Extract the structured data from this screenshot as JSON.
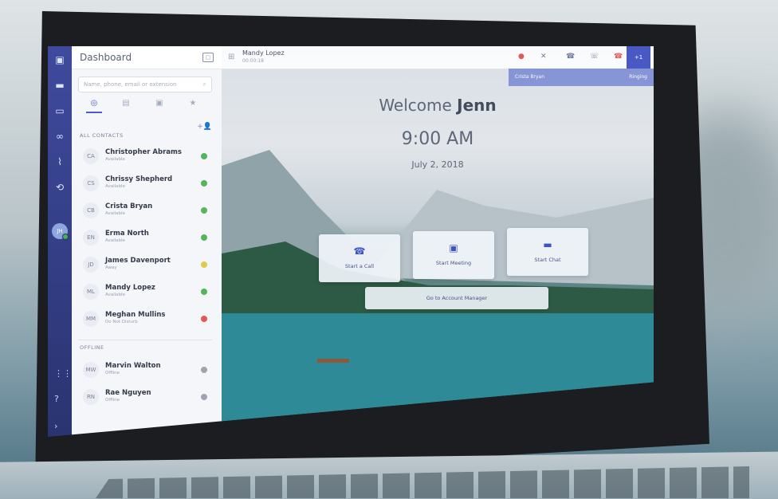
{
  "app": {
    "title": "Dashboard"
  },
  "search": {
    "placeholder": "Name, phone, email or extension"
  },
  "contacts_tabs": [
    {
      "icon": "globe-icon",
      "active": true
    },
    {
      "icon": "building-icon",
      "active": false
    },
    {
      "icon": "id-card-icon",
      "active": false
    },
    {
      "icon": "star-icon",
      "active": false
    }
  ],
  "sections": {
    "all_contacts": "ALL CONTACTS",
    "offline": "OFFLINE"
  },
  "contacts": [
    {
      "initials": "CA",
      "name": "Christopher Abrams",
      "status": "Available",
      "status_color": "#55b45c"
    },
    {
      "initials": "CS",
      "name": "Chrissy Shepherd",
      "status": "Available",
      "status_color": "#55b45c"
    },
    {
      "initials": "CB",
      "name": "Crista Bryan",
      "status": "Available",
      "status_color": "#55b45c"
    },
    {
      "initials": "EN",
      "name": "Erma North",
      "status": "Available",
      "status_color": "#55b45c"
    },
    {
      "initials": "JD",
      "name": "James Davenport",
      "status": "Away",
      "status_color": "#e2c84b"
    },
    {
      "initials": "ML",
      "name": "Mandy Lopez",
      "status": "Available",
      "status_color": "#55b45c"
    },
    {
      "initials": "MM",
      "name": "Meghan Mullins",
      "status": "Do Not Disturb",
      "status_color": "#e15a52"
    }
  ],
  "offline_contacts": [
    {
      "initials": "MW",
      "name": "Marvin Walton",
      "status": "Offline",
      "status_color": "#9ea4b3"
    },
    {
      "initials": "RN",
      "name": "Rae Nguyen",
      "status": "Offline",
      "status_color": "#9ea4b3"
    }
  ],
  "rail": {
    "avatar": "JH"
  },
  "call": {
    "caller": "Mandy Lopez",
    "timer": "00:00:18",
    "plus_label": "+1"
  },
  "ringing": {
    "name": "Crista Bryan",
    "status": "Ringing"
  },
  "welcome": {
    "prefix": "Welcome",
    "name": "Jenn"
  },
  "clock": {
    "time": "9:00 AM",
    "date": "July 2, 2018"
  },
  "actions": {
    "start_call": "Start a Call",
    "start_meeting": "Start Meeting",
    "start_chat": "Start Chat",
    "account_manager": "Go to Account Manager"
  },
  "colors": {
    "accent": "#4a5ccf",
    "rail": "#2f3a85"
  }
}
